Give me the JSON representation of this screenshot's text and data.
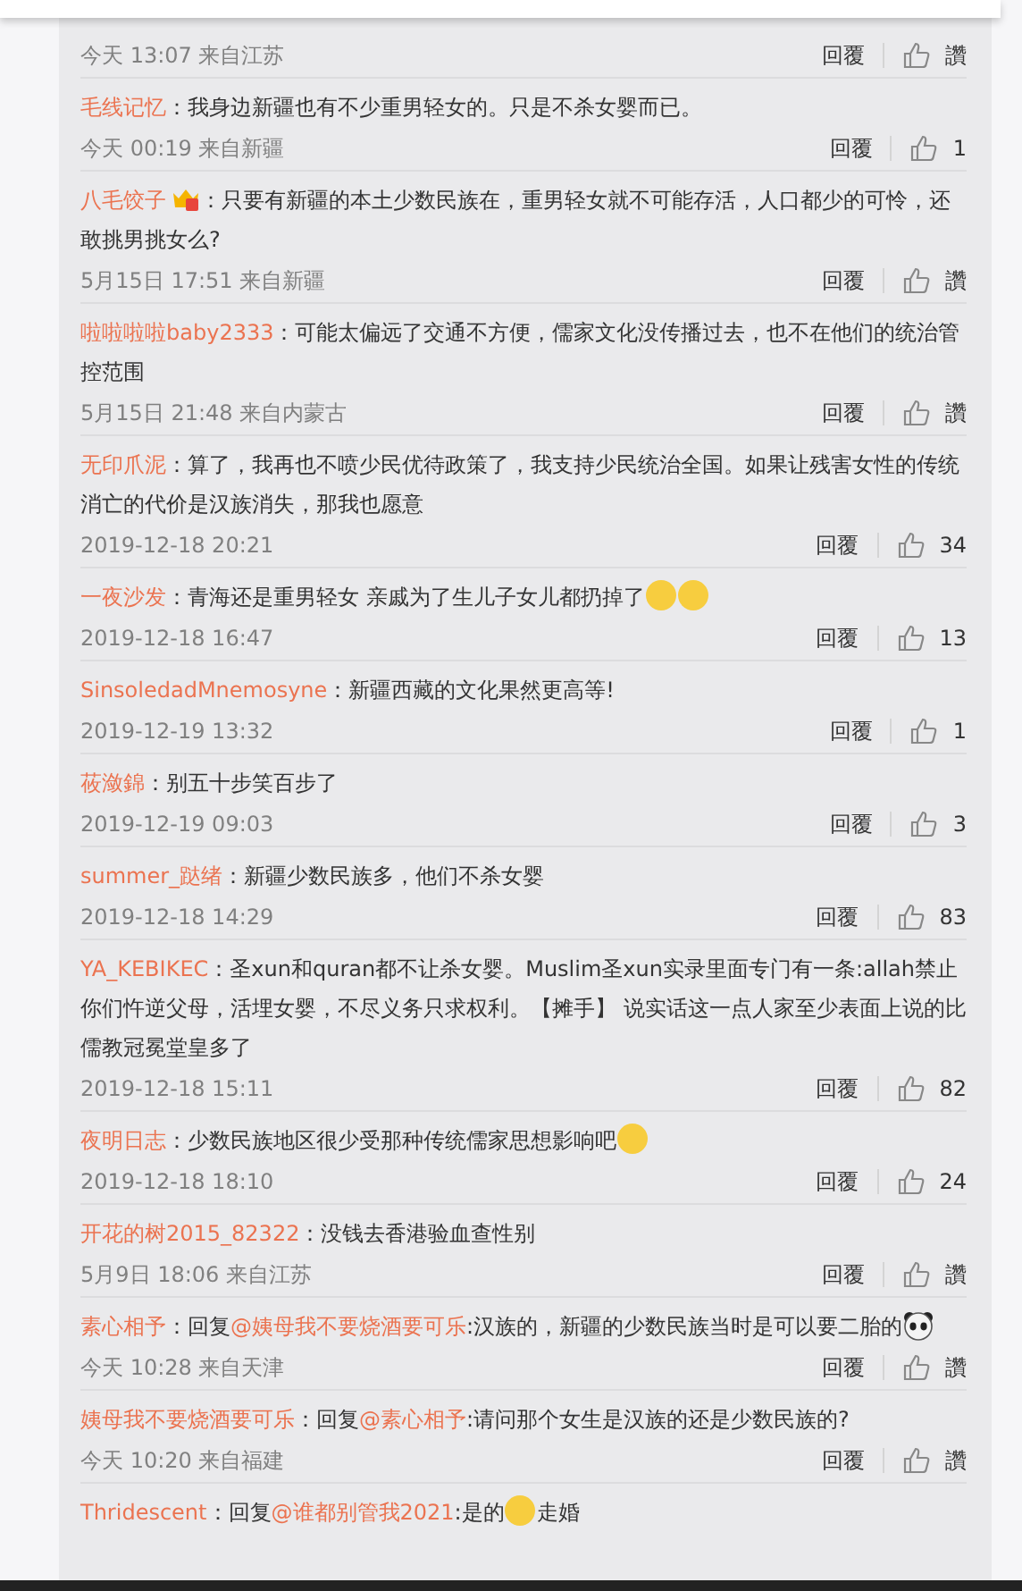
{
  "comments": [
    {
      "meta": "今天 13:07 来自江苏",
      "reply": "回覆",
      "likes": "讚"
    },
    {
      "user": "毛线记忆",
      "badge": false,
      "content": [
        {
          "kind": "text",
          "text": "：我身边新疆也有不少重男轻女的。只是不杀女婴而已。"
        }
      ],
      "meta": "今天 00:19 来自新疆",
      "reply": "回覆",
      "likes": "1"
    },
    {
      "user": "八毛饺子",
      "badge": true,
      "content": [
        {
          "kind": "text",
          "text": "：只要有新疆的本土少数民族在，重男轻女就不可能存活，人口都少的可怜，还敢挑男挑女么?"
        }
      ],
      "meta": "5月15日 17:51 来自新疆",
      "reply": "回覆",
      "likes": "讚"
    },
    {
      "user": "啦啦啦啦baby2333",
      "badge": false,
      "content": [
        {
          "kind": "text",
          "text": "：可能太偏远了交通不方便，儒家文化没传播过去，也不在他们的统治管控范围"
        }
      ],
      "meta": "5月15日 21:48 来自内蒙古",
      "reply": "回覆",
      "likes": "讚"
    },
    {
      "user": "无印爪泥",
      "badge": false,
      "content": [
        {
          "kind": "text",
          "text": "：算了，我再也不喷少民优待政策了，我支持少民统治全国。如果让残害女性的传统消亡的代价是汉族消失，那我也愿意"
        }
      ],
      "meta": "2019-12-18 20:21",
      "reply": "回覆",
      "likes": "34"
    },
    {
      "user": "一夜沙发",
      "badge": false,
      "content": [
        {
          "kind": "text",
          "text": "：青海还是重男轻女 亲戚为了生儿子女儿都扔掉了"
        },
        {
          "kind": "emoji"
        },
        {
          "kind": "emoji"
        }
      ],
      "meta": "2019-12-18 16:47",
      "reply": "回覆",
      "likes": "13"
    },
    {
      "user": "SinsoledadMnemosyne",
      "badge": false,
      "content": [
        {
          "kind": "text",
          "text": "：新疆西藏的文化果然更高等!"
        }
      ],
      "meta": "2019-12-19 13:32",
      "reply": "回覆",
      "likes": "1"
    },
    {
      "user": "莜潋錦",
      "badge": false,
      "content": [
        {
          "kind": "text",
          "text": "：别五十步笑百步了"
        }
      ],
      "meta": "2019-12-19 09:03",
      "reply": "回覆",
      "likes": "3"
    },
    {
      "user": "summer_跶绪",
      "badge": false,
      "content": [
        {
          "kind": "text",
          "text": "：新疆少数民族多，他们不杀女婴"
        }
      ],
      "meta": "2019-12-18 14:29",
      "reply": "回覆",
      "likes": "83"
    },
    {
      "user": "YA_KEBIKEC",
      "badge": false,
      "content": [
        {
          "kind": "text",
          "text": "：圣xun和quran都不让杀女婴。Muslim圣xun实录里面专门有一条:allah禁止你们忤逆父母，活埋女婴，不尽义务只求权利。【摊手】 说实话这一点人家至少表面上说的比儒教冠冕堂皇多了"
        }
      ],
      "meta": "2019-12-18 15:11",
      "reply": "回覆",
      "likes": "82"
    },
    {
      "user": "夜明日志",
      "badge": false,
      "content": [
        {
          "kind": "text",
          "text": "：少数民族地区很少受那种传统儒家思想影响吧"
        },
        {
          "kind": "emoji"
        }
      ],
      "meta": "2019-12-18 18:10",
      "reply": "回覆",
      "likes": "24"
    },
    {
      "user": "开花的树2015_82322",
      "badge": false,
      "content": [
        {
          "kind": "text",
          "text": "：没钱去香港验血查性别"
        }
      ],
      "meta": "5月9日 18:06 来自江苏",
      "reply": "回覆",
      "likes": "讚"
    },
    {
      "user": "素心相予",
      "badge": false,
      "content": [
        {
          "kind": "text",
          "text": "：回复"
        },
        {
          "kind": "mention",
          "text": "@姨母我不要烧酒要可乐"
        },
        {
          "kind": "text",
          "text": ":汉族的，新疆的少数民族当时是可以要二胎的"
        },
        {
          "kind": "sticker"
        }
      ],
      "meta": "今天 10:28 来自天津",
      "reply": "回覆",
      "likes": "讚"
    },
    {
      "user": "姨母我不要烧酒要可乐",
      "badge": false,
      "content": [
        {
          "kind": "text",
          "text": "：回复"
        },
        {
          "kind": "mention",
          "text": "@素心相予"
        },
        {
          "kind": "text",
          "text": ":请问那个女生是汉族的还是少数民族的?"
        }
      ],
      "meta": "今天 10:20 来自福建",
      "reply": "回覆",
      "likes": "讚"
    },
    {
      "user": "Thridescent",
      "badge": false,
      "content": [
        {
          "kind": "text",
          "text": "：回复"
        },
        {
          "kind": "mention",
          "text": "@谁都别管我2021"
        },
        {
          "kind": "text",
          "text": ":是的"
        },
        {
          "kind": "emoji"
        },
        {
          "kind": "text",
          "text": "走婚"
        }
      ]
    }
  ]
}
